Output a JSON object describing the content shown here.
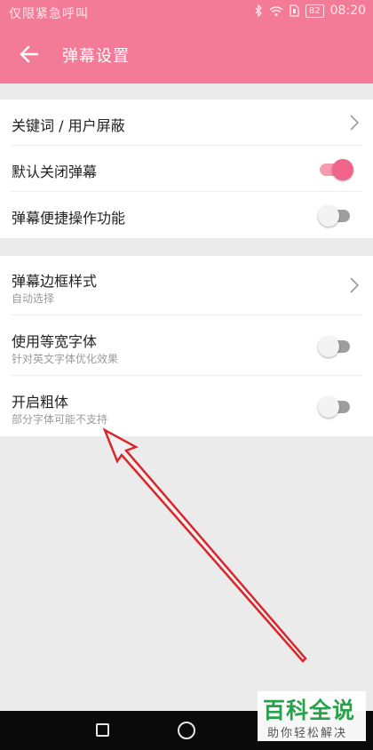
{
  "status_bar": {
    "carrier": "仅限紧急呼叫",
    "battery": "82",
    "time": "08:20"
  },
  "app_bar": {
    "title": "弹幕设置"
  },
  "settings": {
    "group1": [
      {
        "title": "关键词 / 用户屏蔽",
        "control": "chevron"
      },
      {
        "title": "默认关闭弹幕",
        "control": "switch",
        "on": true
      },
      {
        "title": "弹幕便捷操作功能",
        "control": "switch",
        "on": false
      }
    ],
    "group2": [
      {
        "title": "弹幕边框样式",
        "subtitle": "自动选择",
        "control": "chevron"
      },
      {
        "title": "使用等宽字体",
        "subtitle": "针对英文字体优化效果",
        "control": "switch",
        "on": false
      },
      {
        "title": "开启粗体",
        "subtitle": "部分字体可能不支持",
        "control": "switch",
        "on": false
      }
    ]
  },
  "watermark": {
    "main": "百科全说",
    "sub": "助你轻松解决"
  },
  "colors": {
    "accent": "#f47b97",
    "switch_on": "#f0638a",
    "annotation_arrow": "#d9262c",
    "watermark_green": "#27a24a"
  }
}
